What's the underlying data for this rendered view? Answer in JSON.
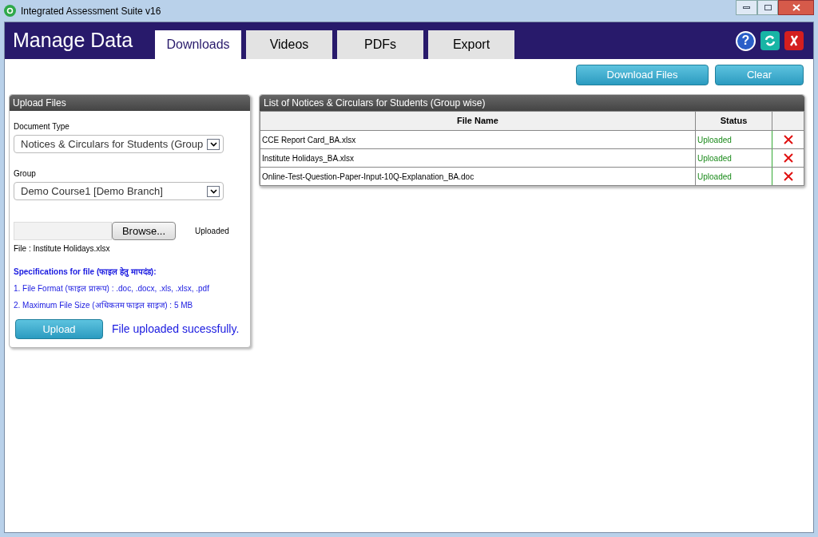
{
  "window": {
    "title": "Integrated Assessment Suite v16"
  },
  "header": {
    "title": "Manage Data",
    "help_symbol": "?"
  },
  "tabs": [
    {
      "label": "Downloads",
      "selected": true
    },
    {
      "label": "Videos",
      "selected": false
    },
    {
      "label": "PDFs",
      "selected": false
    },
    {
      "label": "Export",
      "selected": false
    }
  ],
  "actions": [
    "Download Files",
    "Clear"
  ],
  "upload_panel": {
    "title": "Upload Files",
    "document_type": {
      "label": "Document Type",
      "value": "Notices & Circulars for Students (Group"
    },
    "group": {
      "label": "Group",
      "value": "Demo Course1 [Demo Branch]"
    },
    "browse_button": "Browse...",
    "upload_state": "Uploaded",
    "file_label": "File : Institute Holidays.xlsx",
    "spec_title": "Specifications for file (फाइल हेतु मापदंड):",
    "specs": [
      "1. File Format (फाइल प्रारूप) : .doc, .docx, .xls, .xlsx, .pdf",
      "2. Maximum File Size (अधिकतम फाइल साइज) : 5 MB"
    ],
    "upload_button": "Upload",
    "message": "File uploaded sucessfully."
  },
  "list_panel": {
    "title": "List of Notices & Circulars for Students (Group wise)",
    "columns": [
      "File Name",
      "Status"
    ],
    "rows": [
      {
        "file_name": "CCE Report Card_BA.xlsx",
        "status": "Uploaded"
      },
      {
        "file_name": "Institute Holidays_BA.xlsx",
        "status": "Uploaded"
      },
      {
        "file_name": "Online-Test-Question-Paper-Input-10Q-Explanation_BA.doc",
        "status": "Uploaded"
      }
    ]
  }
}
